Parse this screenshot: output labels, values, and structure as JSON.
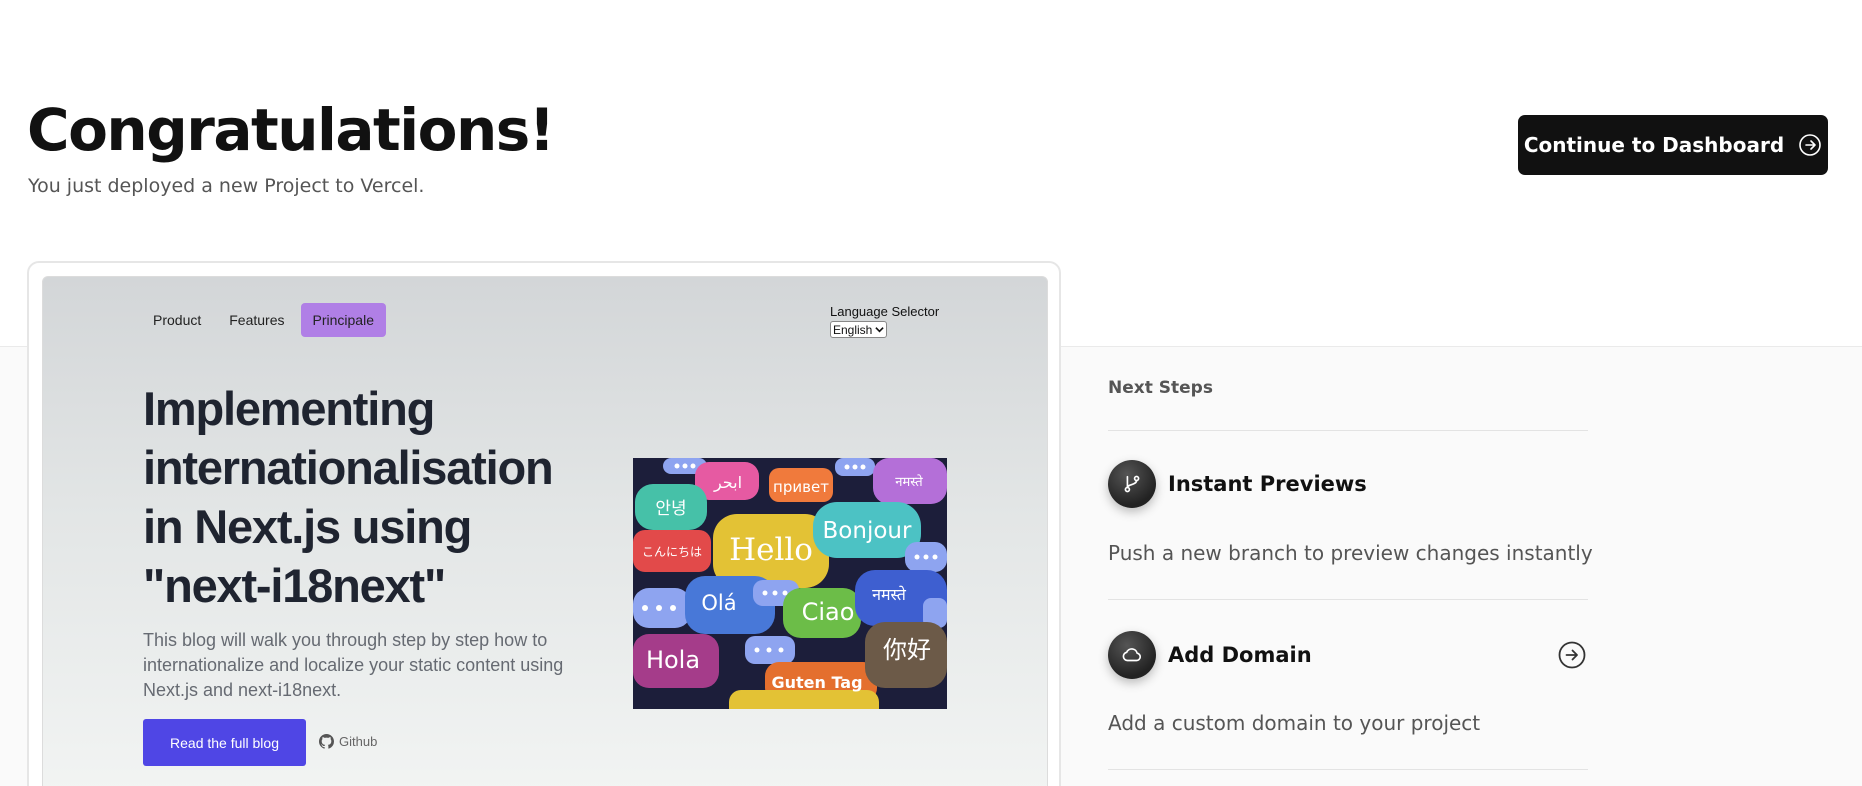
{
  "header": {
    "title": "Congratulations!",
    "subtitle": "You just deployed a new Project to Vercel.",
    "continue_label": "Continue to Dashboard"
  },
  "preview": {
    "nav": [
      "Product",
      "Features",
      "Principale"
    ],
    "language_label": "Language Selector",
    "language_selected": "English",
    "hero_title": "Implementing internationalisation in Next.js using \"next-i18next\"",
    "hero_description": "This blog will walk you through step by step how to internationalize and localize your static content using Next.js and next-i18next.",
    "read_button": "Read the full blog",
    "github_link": "Github",
    "bubble_words": [
      "ابحر",
      "привет",
      "नमस्ते",
      "안녕",
      "Bonjour",
      "こんにちは",
      "Hello",
      "Olá",
      "Ciao",
      "नमस्ते",
      "Hola",
      "你好",
      "Guten Tag"
    ]
  },
  "next_steps": {
    "heading": "Next Steps",
    "items": [
      {
        "title": "Instant Previews",
        "description": "Push a new branch to preview changes instantly",
        "icon": "git-branch-icon"
      },
      {
        "title": "Add Domain",
        "description": "Add a custom domain to your project",
        "icon": "cloud-icon"
      }
    ]
  },
  "colors": {
    "primary_button": "#111111",
    "blog_button": "#4f46e5",
    "active_nav": "#b07fe6"
  }
}
